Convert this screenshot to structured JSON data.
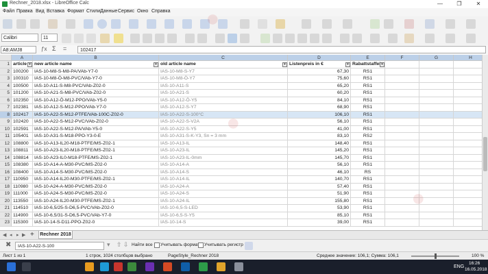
{
  "window": {
    "title": "Rechner_2018.xlsx - LibreOffice Calc",
    "controls": [
      "—",
      "❐",
      "✕"
    ]
  },
  "menu": [
    "Файл",
    "Правка",
    "Вид",
    "Вставка",
    "Формат",
    "Стили",
    "Данные",
    "Сервис",
    "Окно",
    "Справка"
  ],
  "toolbar": {
    "font_name": "Calibri",
    "font_size": "11"
  },
  "formula_bar": {
    "name_box": "A8:AMJ8",
    "content": "102417"
  },
  "columns": [
    "A",
    "B",
    "C",
    "D",
    "E",
    "F",
    "G",
    "H"
  ],
  "headers": {
    "a": "article",
    "b": "new article name",
    "c": "old article name",
    "d": "Listenpreis in €",
    "e": "Rabattstaffel"
  },
  "rows": [
    {
      "n": "2",
      "a": "100200",
      "b": "IAS-10-M8-S-M8-PA/VAb-Y7-0",
      "c": "IAS-10-M8-S-Y7",
      "d": "67,30",
      "e": "RS1"
    },
    {
      "n": "3",
      "a": "100310",
      "b": "IAS-10-M8-Ö-M8-PVC/VAb-Y7-0",
      "c": "IAS-10-M8-Ö-Y7",
      "d": "75,60",
      "e": "RS1"
    },
    {
      "n": "4",
      "a": "100500",
      "b": "IAS-10-A11-S-M8-PVC/VAb-Z02-0",
      "c": "IAS-10-A11-S",
      "d": "65,20",
      "e": "RS1"
    },
    {
      "n": "5",
      "a": "101200",
      "b": "IAS-10-A21-S-M8-PVC/VAb-Z02-0",
      "c": "IAS-10-A21-S",
      "d": "60,20",
      "e": "RS1"
    },
    {
      "n": "6",
      "a": "102350",
      "b": "IAS-10-A12-Ö-M12-PPO/VAb-Y5-0",
      "c": "IAS-10-A12-Ö-Y5",
      "d": "84,10",
      "e": "RS1"
    },
    {
      "n": "7",
      "a": "102381",
      "b": "IAS-10-A12-S-M12-PPO/VAb-Y7-0",
      "c": "IAS-10-A12-S-Y7",
      "d": "68,90",
      "e": "RS1"
    },
    {
      "n": "8",
      "a": "102417",
      "b": "IAS-10-A22-S-M12-PTFE/VAb-100C-Z02-0",
      "c": "IAS-10-A22-S-100°C",
      "d": "106,10",
      "e": "RS1",
      "selected": true
    },
    {
      "n": "9",
      "a": "102420",
      "b": "IAS-10-A22-S-M12-PVC/VAb-Z02-0",
      "c": "IAS-10-A22-S-V2A",
      "d": "56,10",
      "e": "RS1"
    },
    {
      "n": "10",
      "a": "102591",
      "b": "IAS-10-A22-S-M12-PA/VAb-Y5-0",
      "c": "IAS-10-A22-S-Y5",
      "d": "41,00",
      "e": "RS1"
    },
    {
      "n": "11",
      "a": "105401",
      "b": "IAS-10-A31-S-M18-PPO-Y3-0-E",
      "c": "IAS-10-A31-S-K-Y3, Sn = 3 mm",
      "d": "83,10",
      "e": "RS2"
    },
    {
      "n": "12",
      "a": "108800",
      "b": "IAS-10-A13-IL20-M18-PTFE/MS-Z02-1",
      "c": "IAS-10-A13-IL",
      "d": "148,40",
      "e": "RS1"
    },
    {
      "n": "13",
      "a": "108811",
      "b": "IAS-10-A23-IL20-M18-PTFE/MS-Z02-1",
      "c": "IAS-10-A23-IL",
      "d": "145,20",
      "e": "RS1"
    },
    {
      "n": "14",
      "a": "108814",
      "b": "IAS-10-A23-IL0-M18-PTFE/MS-Z02-1",
      "c": "IAS-10-A23-IL-0mm",
      "d": "145,70",
      "e": "RS1"
    },
    {
      "n": "15",
      "a": "108380",
      "b": "IAS-10-A14-A-M30-PVC/MS-Z02-0",
      "c": "IAS-10-A14-A",
      "d": "56,10",
      "e": "RS1"
    },
    {
      "n": "16",
      "a": "108400",
      "b": "IAS-10-A14-S-M30-PVC/MS-Z02-0",
      "c": "IAS-10-A14-S",
      "d": "46,10",
      "e": "RS"
    },
    {
      "n": "17",
      "a": "110950",
      "b": "IAS-10-A14-IL20-M30-PTFE/MS-Z02-1",
      "c": "IAS-10-A14-IL",
      "d": "140,70",
      "e": "RS1"
    },
    {
      "n": "18",
      "a": "110980",
      "b": "IAS-10-A24-A-M30-PVC/MS-Z02-0",
      "c": "IAS-10-A24-A",
      "d": "57,40",
      "e": "RS1"
    },
    {
      "n": "19",
      "a": "111000",
      "b": "IAS-10-A24-S-M30-PVC/MS-Z02-0",
      "c": "IAS-10-A24-S",
      "d": "51,90",
      "e": "RS1"
    },
    {
      "n": "20",
      "a": "113550",
      "b": "IAS-10-A24-IL20-M30-PTFE/MS-Z02-1",
      "c": "IAS-10-A24-IL",
      "d": "155,80",
      "e": "RS1"
    },
    {
      "n": "21",
      "a": "114510",
      "b": "IAS-10-6,5/25-S-D6,5-PVC/VAb-Z02-0",
      "c": "IAS-10-6,5-S-LED",
      "d": "53,90",
      "e": "RS1"
    },
    {
      "n": "22",
      "a": "114900",
      "b": "IAS-10-6,5/31-S-D6,5-PVC/VAb-Y7-0",
      "c": "IAS-10-6,5-S-Y5",
      "d": "85,10",
      "e": "RS1"
    },
    {
      "n": "23",
      "a": "115300",
      "b": "IAS-10-14-S-D11-PPO-Z02-0",
      "c": "IAS-10-14-S",
      "d": "39,00",
      "e": "RS1"
    }
  ],
  "sheet_tab": "Rechner 2018",
  "find_bar": {
    "value": "IAS-10-A22-S-100",
    "find_all": "Найти все",
    "match_format": "Учитывать формат",
    "match_case": "Учитывать регистр"
  },
  "status": {
    "sheet": "Лист 1 из 1",
    "selection": "1 строк, 1024 столбцов выбрано",
    "page_style": "PageStyle_Rechner 2018",
    "summary": "Среднее значение: 106,1; Сумма: 106,1",
    "zoom": "100 %"
  },
  "taskbar": {
    "lang": "ENG",
    "time": "16:26",
    "date": "16.05.2018"
  },
  "colors": {
    "selection": "#d7e6f5",
    "header_sel": "#bcd0e8",
    "accent": "#1d8f3a"
  }
}
